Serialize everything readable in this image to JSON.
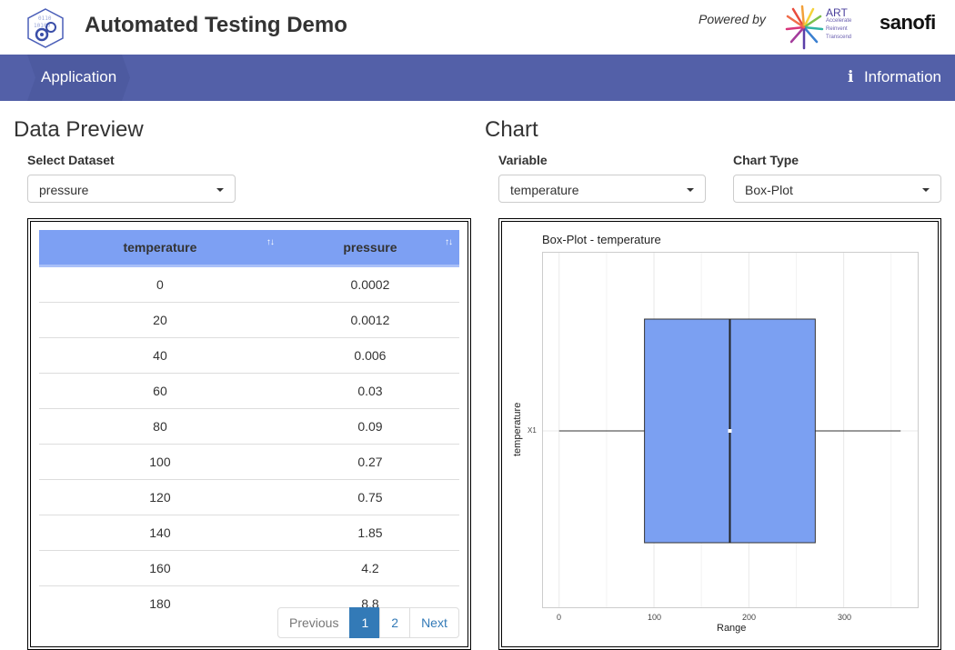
{
  "header": {
    "title": "Automated Testing Demo",
    "powered_by": "Powered by",
    "art_logo": {
      "big": "ART",
      "lines": [
        "Accelerate",
        "Reinvent",
        "Transcend"
      ]
    },
    "sanofi": "sanofi"
  },
  "nav": {
    "tab_label": "Application",
    "info_label": "Information",
    "info_icon": "info-icon"
  },
  "data_preview": {
    "heading": "Data Preview",
    "select_label": "Select Dataset",
    "select_value": "pressure",
    "columns": [
      "temperature",
      "pressure"
    ],
    "rows": [
      [
        "0",
        "0.0002"
      ],
      [
        "20",
        "0.0012"
      ],
      [
        "40",
        "0.006"
      ],
      [
        "60",
        "0.03"
      ],
      [
        "80",
        "0.09"
      ],
      [
        "100",
        "0.27"
      ],
      [
        "120",
        "0.75"
      ],
      [
        "140",
        "1.85"
      ],
      [
        "160",
        "4.2"
      ],
      [
        "180",
        "8.8"
      ]
    ],
    "pager": {
      "previous": "Previous",
      "pages": [
        "1",
        "2"
      ],
      "active_page": "1",
      "next": "Next"
    }
  },
  "chart_panel": {
    "heading": "Chart",
    "variable_label": "Variable",
    "variable_value": "temperature",
    "chart_type_label": "Chart Type",
    "chart_type_value": "Box-Plot"
  },
  "chart_data": {
    "type": "boxplot",
    "orientation": "horizontal",
    "title": "Box-Plot - temperature",
    "xlabel": "Range",
    "ylabel": "temperature",
    "category": "X1",
    "x_ticks": [
      "0",
      "100",
      "200",
      "300"
    ],
    "xlim": [
      -17,
      378
    ],
    "min": 0,
    "q1": 90,
    "median": 180,
    "q3": 270,
    "max": 360,
    "mean": 180,
    "fill": "#7ba0f2",
    "grid": true
  },
  "colors": {
    "navbar": "#5360a8",
    "table_header": "#7da0f3",
    "pager_active": "#337ab7"
  }
}
